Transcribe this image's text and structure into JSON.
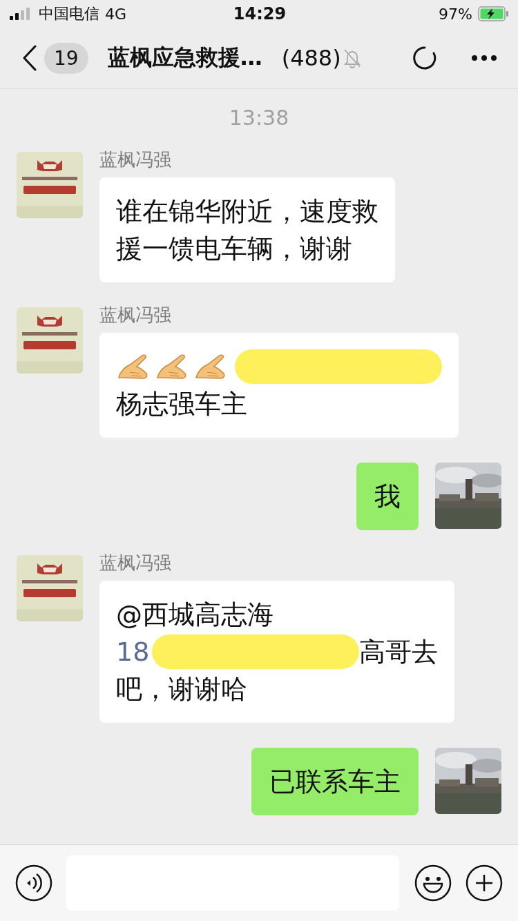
{
  "status_bar": {
    "carrier": "中国电信",
    "network": "4G",
    "time": "14:29",
    "battery": "97%",
    "charging": true
  },
  "nav": {
    "unread": "19",
    "title": "蓝枫应急救援…",
    "count": "(488)",
    "muted": true
  },
  "timestamp": "13:38",
  "messages": [
    {
      "kind": "received",
      "sender": "蓝枫冯强",
      "lines": [
        [
          {
            "kind": "text",
            "text": "谁在锦华附近，速度救"
          }
        ],
        [
          {
            "kind": "text",
            "text": "援一馈电车辆，谢谢"
          }
        ]
      ]
    },
    {
      "kind": "received",
      "sender": "蓝枫冯强",
      "lines": [
        [
          {
            "kind": "emoji"
          },
          {
            "kind": "emoji"
          },
          {
            "kind": "emoji"
          },
          {
            "kind": "scribble"
          }
        ],
        [
          {
            "kind": "text",
            "text": "杨志强车主"
          }
        ]
      ]
    },
    {
      "kind": "sent",
      "lines": [
        [
          {
            "kind": "text",
            "text": "我"
          }
        ]
      ]
    },
    {
      "kind": "received",
      "sender": "蓝枫冯强",
      "lines": [
        [
          {
            "kind": "text",
            "text": "@西城高志海"
          }
        ],
        [
          {
            "kind": "link",
            "text": "18"
          },
          {
            "kind": "scribble"
          },
          {
            "kind": "text",
            "text": "高哥去"
          }
        ],
        [
          {
            "kind": "text",
            "text": "吧，谢谢哈"
          }
        ]
      ]
    },
    {
      "kind": "sent",
      "lines": [
        [
          {
            "kind": "text",
            "text": "已联系车主"
          }
        ]
      ]
    }
  ]
}
